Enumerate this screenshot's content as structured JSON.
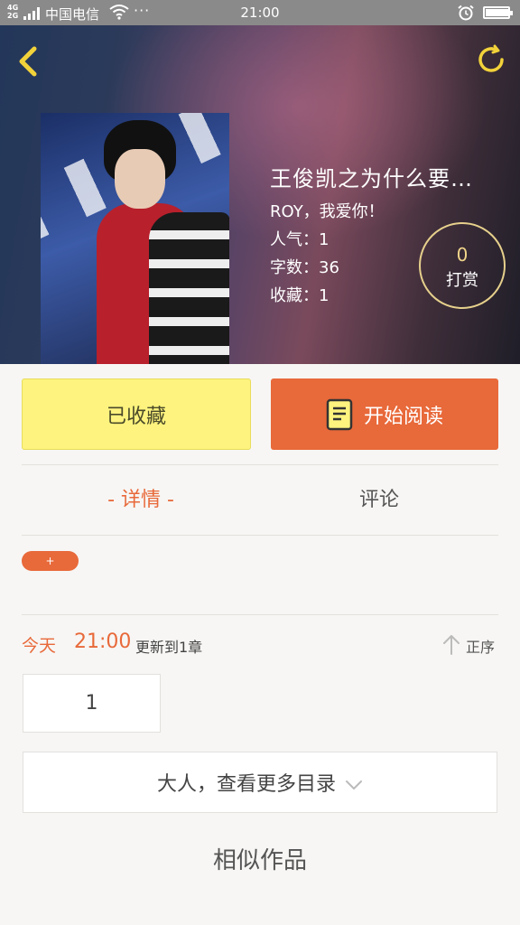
{
  "status_bar": {
    "network": "4G\n2G",
    "carrier": "中国电信",
    "menu_dots": "···",
    "time": "21:00",
    "battery_level": 0.95
  },
  "book": {
    "title": "王俊凯之为什么要…",
    "subtitle": "ROY，我爱你！",
    "popularity": "人气：1",
    "word_count": "字数：36",
    "favorites": "收藏：1"
  },
  "reward": {
    "amount": "0",
    "label": "打赏"
  },
  "actions": {
    "favorited_label": "已收藏",
    "read_label": "开始阅读"
  },
  "tabs": {
    "details": "- 详情 -",
    "comments": "评论"
  },
  "tag": {
    "label": "+"
  },
  "update": {
    "day": "今天",
    "time": "21:00",
    "desc": "更新到1章",
    "sort_label": "正序"
  },
  "chapters": [
    "1"
  ],
  "more_catalog": "大人，查看更多目录",
  "similar_works": "相似作品",
  "colors": {
    "accent": "#e8693a",
    "favorite_bg": "#fdf37e",
    "reward_ring": "#e6d08c"
  }
}
